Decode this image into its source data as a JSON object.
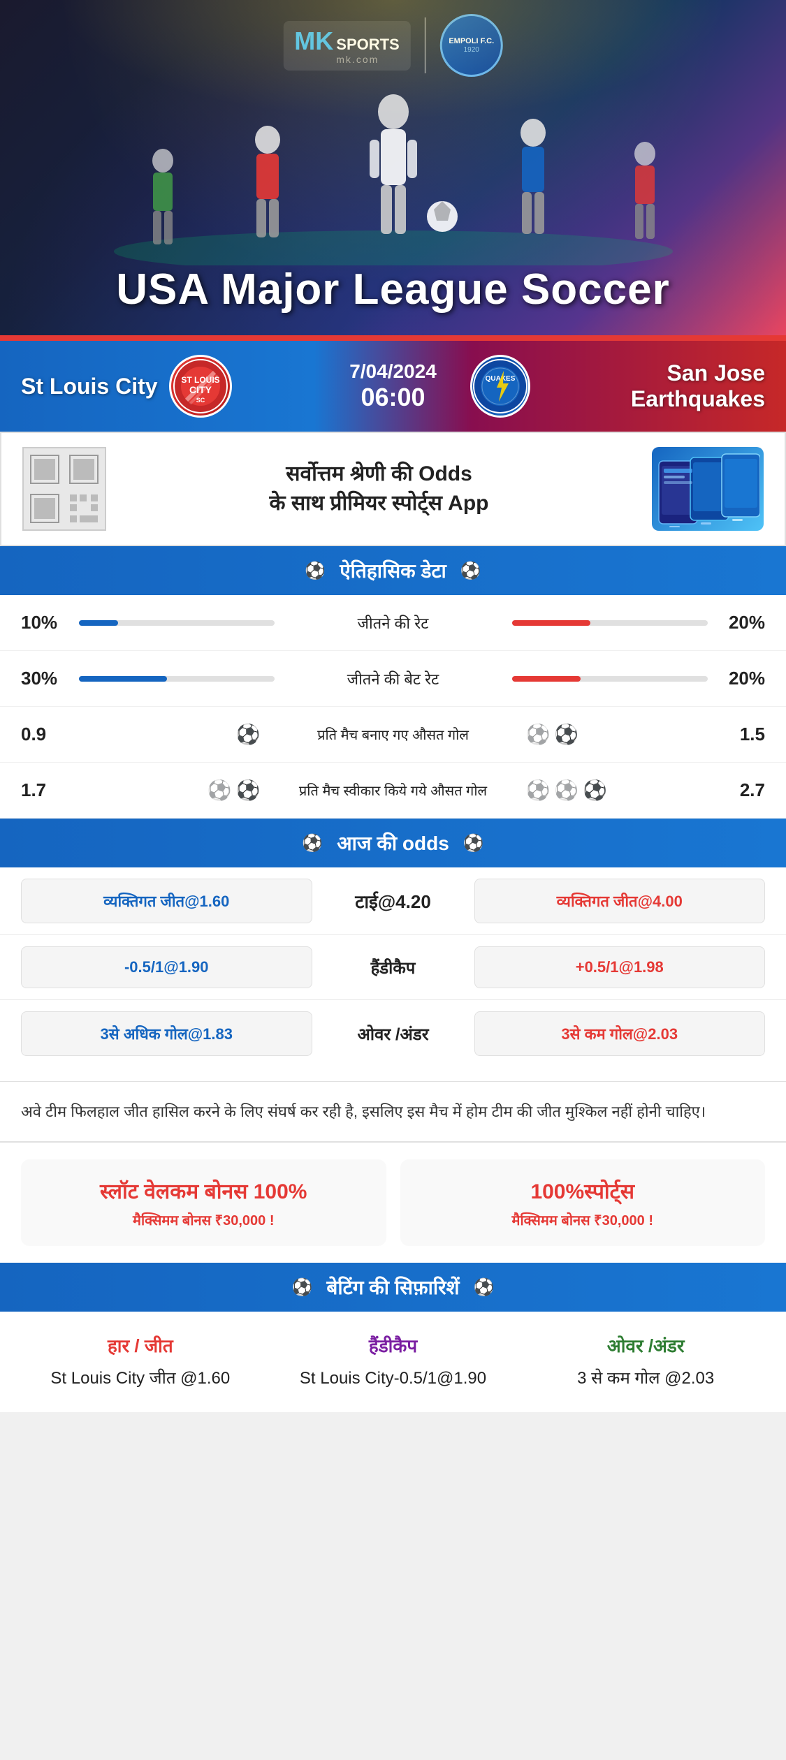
{
  "brand": {
    "name_mk": "MK",
    "name_sports": "SPORTS",
    "domain": "mk.com",
    "partner": "EMPOLI F.C.",
    "partner_year": "1920"
  },
  "hero": {
    "league_title": "USA Major League Soccer"
  },
  "match": {
    "date": "7/04/2024",
    "time": "06:00",
    "team_home": "St Louis City",
    "team_away": "San Jose Earthquakes",
    "team_away_short": "QUAKES",
    "team_home_short": "CITY"
  },
  "promo": {
    "text_line1": "सर्वोत्तम श्रेणी की Odds",
    "text_line2": "के साथ प्रीमियर स्पोर्ट्स App"
  },
  "sections": {
    "historical": "ऐतिहासिक डेटा",
    "odds": "आज की odds",
    "betting": "बेटिंग की सिफ़ारिशें"
  },
  "stats": [
    {
      "label": "जीतने की रेट",
      "left_val": "10%",
      "right_val": "20%",
      "left_pct": 20,
      "right_pct": 40
    },
    {
      "label": "जीतने की बेट रेट",
      "left_val": "30%",
      "right_val": "20%",
      "left_pct": 45,
      "right_pct": 35
    }
  ],
  "goal_stats": [
    {
      "label": "प्रति मैच बनाए गए औसत गोल",
      "left_val": "0.9",
      "right_val": "1.5",
      "left_balls": 1,
      "right_balls": 2
    },
    {
      "label": "प्रति मैच स्वीकार किये गये औसत गोल",
      "left_val": "1.7",
      "right_val": "2.7",
      "left_balls": 2,
      "right_balls": 3
    }
  ],
  "odds": [
    {
      "left_label": "व्यक्तिगत जीत@1.60",
      "center_label": "टाई@4.20",
      "right_label": "व्यक्तिगत जीत@4.00"
    },
    {
      "left_label": "-0.5/1@1.90",
      "center_label": "हैंडीकैप",
      "right_label": "+0.5/1@1.98"
    },
    {
      "left_label": "3से अधिक गोल@1.83",
      "center_label": "ओवर /अंडर",
      "right_label": "3से कम गोल@2.03"
    }
  ],
  "description": "अवे टीम फिलहाल जीत हासिल करने के लिए संघर्ष कर रही है, इसलिए इस मैच में होम टीम की जीत मुश्किल नहीं होनी चाहिए।",
  "bonus": [
    {
      "title": "स्लॉट वेलकम बोनस 100%",
      "subtitle": "मैक्सिमम बोनस ₹30,000  !"
    },
    {
      "title": "100%स्पोर्ट्स",
      "subtitle": "मैक्सिमम बोनस  ₹30,000 !"
    }
  ],
  "recommendations": [
    {
      "header": "हार / जीत",
      "value": "St Louis City जीत @1.60",
      "color": "red"
    },
    {
      "header": "हैंडीकैप",
      "value": "St Louis City-0.5/1@1.90",
      "color": "purple"
    },
    {
      "header": "ओवर /अंडर",
      "value": "3 से कम गोल @2.03",
      "color": "green"
    }
  ]
}
